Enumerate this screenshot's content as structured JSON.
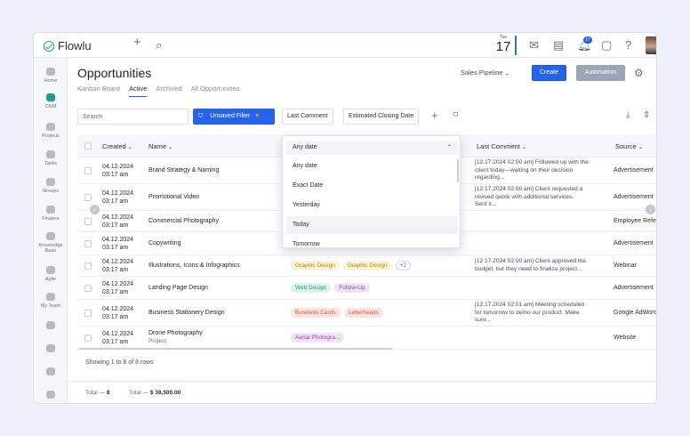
{
  "app": {
    "name": "Flowlu"
  },
  "topbar": {
    "date_dow": "Tue",
    "date_day": "17",
    "notifications_count": "17"
  },
  "sidebar": {
    "items": [
      {
        "label": "Home",
        "icon": "home-icon"
      },
      {
        "label": "CRM",
        "icon": "crm-icon",
        "active": true
      },
      {
        "label": "Projects",
        "icon": "projects-icon"
      },
      {
        "label": "Tasks",
        "icon": "tasks-icon"
      },
      {
        "label": "Groups",
        "icon": "groups-icon"
      },
      {
        "label": "Finance",
        "icon": "finance-icon"
      },
      {
        "label": "Knowledge",
        "label2": "Base",
        "icon": "knowledge-base-icon"
      },
      {
        "label": "Agile",
        "icon": "agile-icon"
      },
      {
        "label": "My Team",
        "icon": "my-team-icon"
      }
    ]
  },
  "page": {
    "title": "Opportunities",
    "tabs": [
      "Kanban Board",
      "Active",
      "Archived",
      "All Opportunities"
    ],
    "active_tab": "Active",
    "pipeline": "Sales Pipeline",
    "create": "Create",
    "automation": "Automation"
  },
  "filters": {
    "search_placeholder": "Search",
    "unsaved": "Unsaved Filter",
    "last_comment": "Last Comment",
    "closing_date": "Estimated Closing Date"
  },
  "table": {
    "headers": {
      "created": "Created",
      "name": "Name",
      "last_comment": "Last Comment",
      "source": "Source"
    },
    "rows": [
      {
        "date": "04.12.2024",
        "time": "03:17 am",
        "name": "Brand Strategy & Naming",
        "sub": "",
        "tags": [],
        "more": "",
        "comment": [
          "[12.17.2024 02:00 am] Followed up with the",
          "client today—waiting on their decision",
          "regarding..."
        ],
        "source": "Advertisement"
      },
      {
        "date": "04.12.2024",
        "time": "03:17 am",
        "name": "Promotional Video",
        "sub": "",
        "tags": [],
        "more": "",
        "comment": [
          "[12.17.2024 02:00 am] Client requested a",
          "revised quote with additional services.",
          "Sent it..."
        ],
        "source": "Advertisement"
      },
      {
        "date": "04.12.2024",
        "time": "03:17 am",
        "name": "Commercial Photography",
        "sub": "",
        "tags": [],
        "more": "",
        "comment": [],
        "source": "Employee Referral"
      },
      {
        "date": "04.12.2024",
        "time": "03:17 am",
        "name": "Copywriting",
        "sub": "",
        "tags": [],
        "more": "",
        "comment": [],
        "source": "Advertisement"
      },
      {
        "date": "04.12.2024",
        "time": "03:17 am",
        "name": "Illustrations, Icons & Infographics",
        "sub": "",
        "tags": [
          {
            "label": "Graphic Design",
            "bg": "#fdf3d7",
            "fg": "#b8860b"
          },
          {
            "label": "Graphic Design",
            "bg": "#fdf3d7",
            "fg": "#b8860b"
          }
        ],
        "more": "+2",
        "comment": [
          "[12.17.2024 02:00 am] Client approved the",
          "budget, but they need to finalize project..."
        ],
        "source": "Webinar"
      },
      {
        "date": "04.12.2024",
        "time": "03:17 am",
        "name": "Landing Page Design",
        "sub": "",
        "tags": [
          {
            "label": "Web Design",
            "bg": "#dcf4ee",
            "fg": "#1f9d8b"
          },
          {
            "label": "Follow-Up",
            "bg": "#f2e3f8",
            "fg": "#9b3fb5"
          }
        ],
        "more": "",
        "comment": [],
        "source": "Advertisement"
      },
      {
        "date": "04.12.2024",
        "time": "03:17 am",
        "name": "Business Stationery Design",
        "sub": "",
        "tags": [
          {
            "label": "Business Cards",
            "bg": "#fde4e1",
            "fg": "#d5563f"
          },
          {
            "label": "Letterheads",
            "bg": "#fde4e1",
            "fg": "#d5563f"
          }
        ],
        "more": "",
        "comment": [
          "[12.17.2024 02:01 am] Meeting scheduled",
          "for tomorrow to demo our product. Make",
          "sure..."
        ],
        "source": "Google AdWords"
      },
      {
        "date": "04.12.2024",
        "time": "03:17 am",
        "name": "Drone Photography",
        "sub": "Project",
        "tags": [
          {
            "label": "Aerial Photogra...",
            "bg": "#f2e3f8",
            "fg": "#9b3fb5"
          }
        ],
        "more": "",
        "comment": [],
        "source": "Website"
      }
    ]
  },
  "dropdown": {
    "selected": "Any date",
    "options": [
      "Any date",
      "Exact Date",
      "Yesterday",
      "Today",
      "Tomorrow"
    ],
    "hovered": "Today"
  },
  "status": {
    "showing": "Showing 1 to 8 of 8 rows"
  },
  "footer": {
    "total_label": "Total —",
    "total_count": "8",
    "total_sum_label": "Total —",
    "total_sum": "$ 38,500.00"
  }
}
